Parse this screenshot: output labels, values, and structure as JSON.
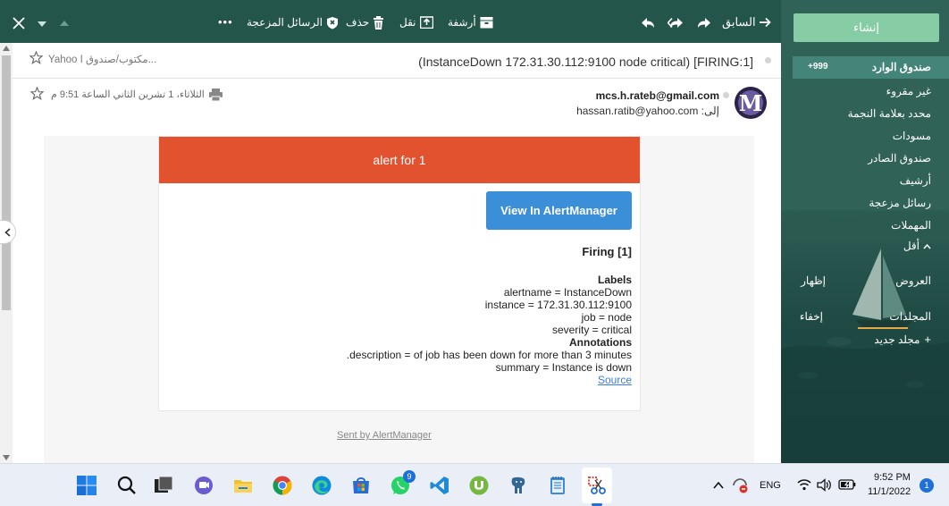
{
  "toolbar": {
    "back_label": "السابق",
    "archive_label": "أرشفة",
    "move_label": "نقل",
    "delete_label": "حذف",
    "spam_label": "الرسائل المزعجة",
    "more_label": "•••"
  },
  "sidebar": {
    "compose_label": "إنشاء",
    "inbox_label": "صندوق الوارد",
    "inbox_count": "+999",
    "items": [
      {
        "label": "غير مقروء"
      },
      {
        "label": "محدد بعلامة النجمة"
      },
      {
        "label": "مسودات"
      },
      {
        "label": "صندوق الصادر"
      },
      {
        "label": "أرشيف"
      },
      {
        "label": "رسائل مزعجة"
      },
      {
        "label": "المهملات"
      },
      {
        "label": "أقل"
      }
    ],
    "offers_label": "العروض",
    "offers_action": "إظهار",
    "folders_label": "المجلدات",
    "folders_action": "إخفاء",
    "new_folder_label": "مجلد جديد"
  },
  "message": {
    "subject": "(InstanceDown 172.31.30.112:9100 node critical) [FIRING:1]",
    "folder_path": "Yahoo مكتوب/صندوق ا...",
    "from": "mcs.h.rateb@gmail.com",
    "to_prefix": "إلى:",
    "to": "hassan.ratib@yahoo.com",
    "date": "الثلاثاء، 1 تشرين الثاني الساعة 9:51 م",
    "avatar_letter": "M"
  },
  "alert": {
    "header": "alert for 1",
    "button": "View In AlertManager",
    "firing": "Firing [1]",
    "labels_title": "Labels",
    "labels": [
      "alertname = InstanceDown",
      "instance = 172.31.30.112:9100",
      "job = node",
      "severity = critical"
    ],
    "annotations_title": "Annotations",
    "annotations": [
      ".description = of job has been down for more than 3 minutes",
      "summary = Instance is down"
    ],
    "source_link": "Source",
    "sent_by": "Sent by AlertManager"
  },
  "taskbar": {
    "whatsapp_badge": "9",
    "language": "ENG",
    "time": "9:52 PM",
    "date": "11/1/2022",
    "notification_count": "1"
  },
  "colors": {
    "toolbar_bg": "#24554b",
    "sidebar_bg": "#2f5f55",
    "compose_bg": "#86cda6",
    "alert_header": "#e3522f",
    "button_blue": "#3b8ed8"
  }
}
